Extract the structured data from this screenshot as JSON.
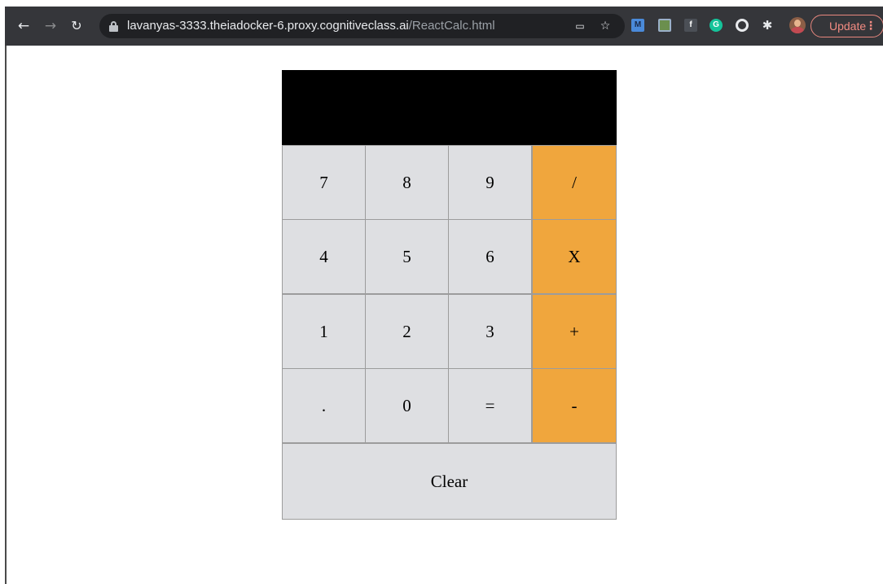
{
  "browser": {
    "url_host": "lavanyas-3333.theiadocker-6.proxy.cognitiveclass.ai",
    "url_path": "/ReactCalc.html",
    "nav": {
      "back_icon": "arrow-left-icon",
      "forward_icon": "arrow-right-icon",
      "reload_icon": "reload-icon"
    },
    "extensions": [
      {
        "name": "m-extension-icon",
        "label": "M",
        "color": "#4a8ad9"
      },
      {
        "name": "image-extension-icon",
        "label": "",
        "color": "#6b8f4e"
      },
      {
        "name": "facebook-extension-icon",
        "label": "f",
        "color": "#4b4f56"
      },
      {
        "name": "grammarly-extension-icon",
        "label": "G",
        "color": "#15c39a"
      },
      {
        "name": "circle-extension-icon",
        "label": "",
        "color": "#e8eaed"
      }
    ],
    "update_label": "Update",
    "menu_glyph": "⋮"
  },
  "calculator": {
    "display_value": "",
    "keys": {
      "k7": "7",
      "k8": "8",
      "k9": "9",
      "divide": "/",
      "k4": "4",
      "k5": "5",
      "k6": "6",
      "multiply": "X",
      "k1": "1",
      "k2": "2",
      "k3": "3",
      "plus": "+",
      "dot": ".",
      "k0": "0",
      "equals": "=",
      "minus": "-",
      "clear": "Clear"
    },
    "colors": {
      "display_bg": "#000000",
      "key_bg": "#dedfe2",
      "operator_bg": "#f0a63d"
    }
  }
}
